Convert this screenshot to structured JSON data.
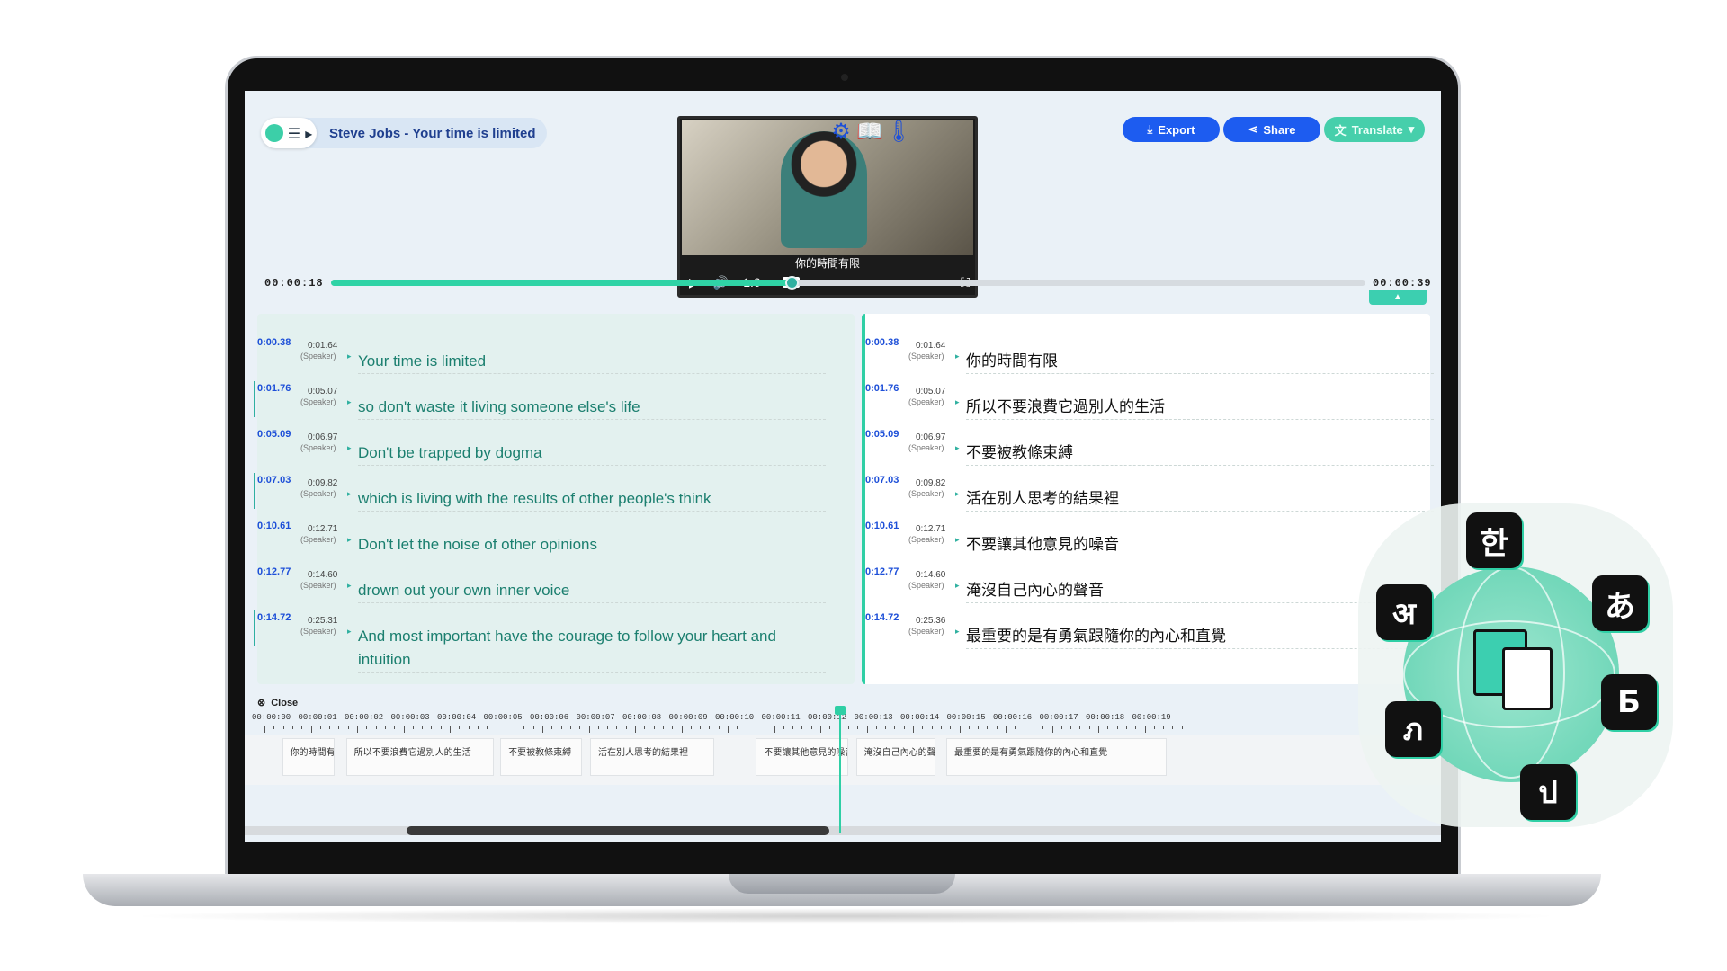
{
  "header": {
    "title": "Steve Jobs - Your time is limited",
    "menu_glyph": "☰ ▸"
  },
  "video": {
    "subtitle": "你的時間有限",
    "speed": "1.0×",
    "cc": "CC"
  },
  "toolbar": {
    "export_label": "Export",
    "share_label": "Share",
    "translate_label": "Translate"
  },
  "progress": {
    "current": "00:00:18",
    "total": "00:00:39",
    "fraction": 0.445
  },
  "speaker_label": "(Speaker)",
  "transcript_left": [
    {
      "start": "0:00.38",
      "end": "0:01.64",
      "text": "Your time is limited"
    },
    {
      "start": "0:01.76",
      "end": "0:05.07",
      "text": "so don't waste it living someone else's life"
    },
    {
      "start": "0:05.09",
      "end": "0:06.97",
      "text": "Don't be trapped by dogma"
    },
    {
      "start": "0:07.03",
      "end": "0:09.82",
      "text": "which is living with the results of other people's think"
    },
    {
      "start": "0:10.61",
      "end": "0:12.71",
      "text": "Don't let the noise of other opinions"
    },
    {
      "start": "0:12.77",
      "end": "0:14.60",
      "text": "drown out your own inner voice"
    },
    {
      "start": "0:14.72",
      "end": "0:25.31",
      "text": "And most important have the courage to follow your heart and intuition"
    }
  ],
  "transcript_right": [
    {
      "start": "0:00.38",
      "end": "0:01.64",
      "text": "你的時間有限"
    },
    {
      "start": "0:01.76",
      "end": "0:05.07",
      "text": "所以不要浪費它過別人的生活"
    },
    {
      "start": "0:05.09",
      "end": "0:06.97",
      "text": "不要被教條束縛"
    },
    {
      "start": "0:07.03",
      "end": "0:09.82",
      "text": "活在別人思考的結果裡"
    },
    {
      "start": "0:10.61",
      "end": "0:12.71",
      "text": "不要讓其他意見的噪音"
    },
    {
      "start": "0:12.77",
      "end": "0:14.60",
      "text": "淹沒自己內心的聲音"
    },
    {
      "start": "0:14.72",
      "end": "0:25.36",
      "text": "最重要的是有勇氣跟隨你的內心和直覺"
    }
  ],
  "timeline": {
    "close_label": "Close",
    "ticks": [
      "00:00:00",
      "00:00:01",
      "00:00:02",
      "00:00:03",
      "00:00:04",
      "00:00:05",
      "00:00:06",
      "00:00:07",
      "00:00:08",
      "00:00:09",
      "00:00:10",
      "00:00:11",
      "00:00:12",
      "00:00:13",
      "00:00:14",
      "00:00:15",
      "00:00:16",
      "00:00:17",
      "00:00:18",
      "00:00:19"
    ],
    "clips": [
      {
        "text": "你的時間有限",
        "start": 0.38,
        "end": 1.64
      },
      {
        "text": "所以不要浪費它過別人的生活",
        "start": 1.76,
        "end": 5.07
      },
      {
        "text": "不要被教條束縛",
        "start": 5.09,
        "end": 6.97
      },
      {
        "text": "活在別人思考的結果裡",
        "start": 7.03,
        "end": 9.82
      },
      {
        "text": "不要讓其他意見的噪音",
        "start": 10.61,
        "end": 12.71
      },
      {
        "text": "淹沒自己內心的聲音",
        "start": 12.77,
        "end": 14.6
      },
      {
        "text": "最重要的是有勇氣跟隨你的內心和直覺",
        "start": 14.72,
        "end": 19.6
      }
    ]
  },
  "glyphs": [
    "한",
    "あ",
    "अ",
    "Б",
    "ภ",
    "ป"
  ],
  "colors": {
    "accent": "#2fcfa5",
    "primary": "#1d5cf0"
  }
}
